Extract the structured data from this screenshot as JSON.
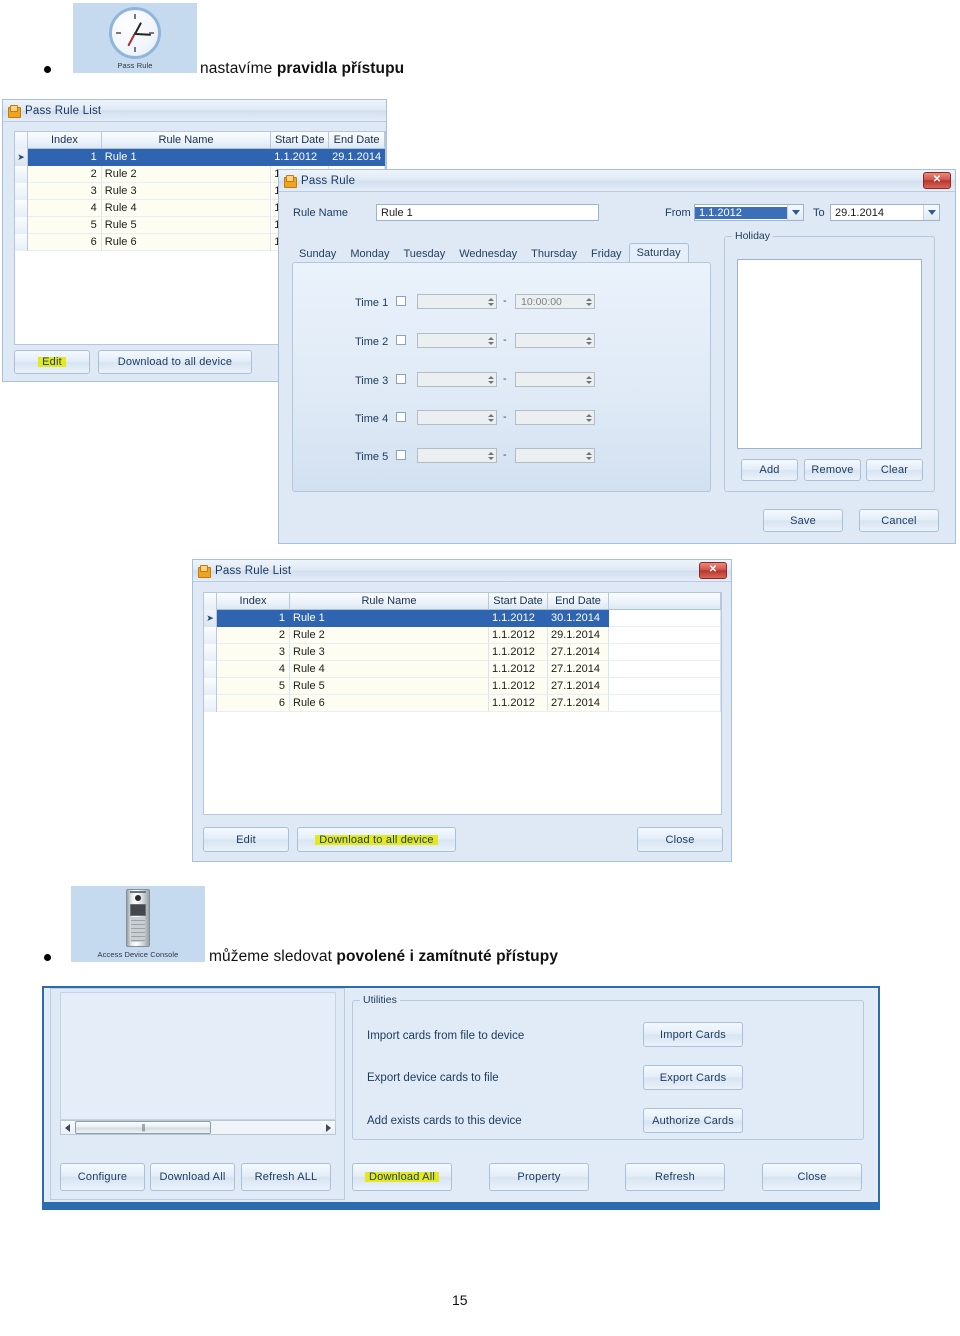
{
  "page": {
    "number": "15"
  },
  "section1": {
    "icon_tile": {
      "caption": "Pass Rule",
      "icon": "clock-icon"
    },
    "bullet_text_plain": "nastavíme ",
    "bullet_text_bold": "pravidla přístupu"
  },
  "section2": {
    "icon_tile": {
      "caption": "Access Device Console",
      "icon": "intercom-device-icon"
    },
    "bullet_text_plain": "můžeme sledovat ",
    "bullet_text_bold": "povolené i zamítnuté přístupy"
  },
  "pass_rule_list_back": {
    "title": "Pass Rule List",
    "columns": [
      "Index",
      "Rule Name",
      "Start Date",
      "End Date"
    ],
    "rows": [
      {
        "index": "1",
        "name": "Rule 1",
        "start": "1.1.2012",
        "end": "29.1.2014",
        "selected": true
      },
      {
        "index": "2",
        "name": "Rule 2",
        "start": "1.",
        "end": "",
        "selected": false
      },
      {
        "index": "3",
        "name": "Rule 3",
        "start": "1.",
        "end": "",
        "selected": false
      },
      {
        "index": "4",
        "name": "Rule 4",
        "start": "1.",
        "end": "",
        "selected": false
      },
      {
        "index": "5",
        "name": "Rule 5",
        "start": "1.",
        "end": "",
        "selected": false
      },
      {
        "index": "6",
        "name": "Rule 6",
        "start": "1.",
        "end": "",
        "selected": false
      }
    ],
    "buttons": {
      "edit": "Edit",
      "download_all_device": "Download to  all device"
    }
  },
  "pass_rule_dialog": {
    "title": "Pass Rule",
    "close_glyph": "✕",
    "rule_name_label": "Rule Name",
    "rule_name_value": "Rule 1",
    "from_label": "From",
    "from_value": "1.1.2012",
    "to_label": "To",
    "to_value": "29.1.2014",
    "day_tabs": [
      "Sunday",
      "Monday",
      "Tuesday",
      "Wednesday",
      "Thursday",
      "Friday",
      "Saturday"
    ],
    "active_day_tab": "Saturday",
    "time_rows": [
      {
        "label": "Time 1",
        "checked": false,
        "start": "",
        "end": "10:00:00"
      },
      {
        "label": "Time 2",
        "checked": false,
        "start": "",
        "end": ""
      },
      {
        "label": "Time 3",
        "checked": false,
        "start": "",
        "end": ""
      },
      {
        "label": "Time 4",
        "checked": false,
        "start": "",
        "end": ""
      },
      {
        "label": "Time 5",
        "checked": false,
        "start": "",
        "end": ""
      }
    ],
    "separator": "-",
    "holiday": {
      "legend": "Holiday",
      "items": [],
      "buttons": {
        "add": "Add",
        "remove": "Remove",
        "clear": "Clear"
      }
    },
    "footer": {
      "save": "Save",
      "cancel": "Cancel"
    }
  },
  "pass_rule_list_front": {
    "title": "Pass Rule List",
    "close_glyph": "✕",
    "columns": [
      "Index",
      "Rule Name",
      "Start Date",
      "End Date"
    ],
    "rows": [
      {
        "index": "1",
        "name": "Rule 1",
        "start": "1.1.2012",
        "end": "30.1.2014",
        "selected": true
      },
      {
        "index": "2",
        "name": "Rule 2",
        "start": "1.1.2012",
        "end": "29.1.2014",
        "selected": false
      },
      {
        "index": "3",
        "name": "Rule 3",
        "start": "1.1.2012",
        "end": "27.1.2014",
        "selected": false
      },
      {
        "index": "4",
        "name": "Rule 4",
        "start": "1.1.2012",
        "end": "27.1.2014",
        "selected": false
      },
      {
        "index": "5",
        "name": "Rule 5",
        "start": "1.1.2012",
        "end": "27.1.2014",
        "selected": false
      },
      {
        "index": "6",
        "name": "Rule 6",
        "start": "1.1.2012",
        "end": "27.1.2014",
        "selected": false
      }
    ],
    "buttons": {
      "edit": "Edit",
      "download_all_device": "Download to  all device",
      "close": "Close"
    },
    "highlighted_button": "Download to  all device"
  },
  "access_device_console": {
    "utilities": {
      "legend": "Utilities",
      "rows": [
        {
          "text": "Import cards from file to device",
          "button": "Import Cards"
        },
        {
          "text": "Export device cards to file",
          "button": "Export Cards"
        },
        {
          "text": "Add exists cards to this device",
          "button": "Authorize Cards"
        }
      ]
    },
    "left_buttons": [
      "Configure",
      "Download All",
      "Refresh ALL"
    ],
    "right_buttons": [
      "Download All",
      "Property",
      "Refresh",
      "Close"
    ],
    "highlighted_button": "Download All"
  },
  "colors": {
    "selection_blue": "#2f64b0",
    "highlight_yellow": "#e4e81f",
    "window_chrome": "#dfe9f5",
    "title_text": "#17375e",
    "frame_dark_blue": "#1f5c9e"
  }
}
